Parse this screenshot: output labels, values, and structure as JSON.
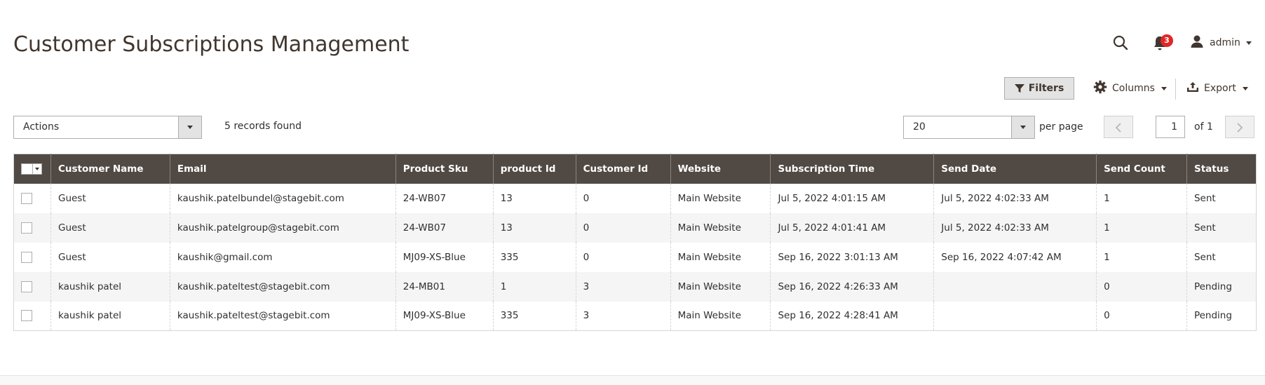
{
  "page": {
    "title": "Customer Subscriptions Management"
  },
  "header": {
    "notification_count": "3",
    "user_name": "admin"
  },
  "toolbar": {
    "filters_label": "Filters",
    "columns_label": "Columns",
    "export_label": "Export"
  },
  "grid_controls": {
    "actions_label": "Actions",
    "records_found": "5 records found",
    "per_page_value": "20",
    "per_page_label": "per page",
    "current_page": "1",
    "page_of": "of 1"
  },
  "table": {
    "columns": [
      "Customer Name",
      "Email",
      "Product Sku",
      "product Id",
      "Customer Id",
      "Website",
      "Subscription Time",
      "Send Date",
      "Send Count",
      "Status"
    ],
    "rows": [
      [
        "Guest",
        "kaushik.patelbundel@stagebit.com",
        "24-WB07",
        "13",
        "0",
        "Main Website",
        "Jul 5, 2022 4:01:15 AM",
        "Jul 5, 2022 4:02:33 AM",
        "1",
        "Sent"
      ],
      [
        "Guest",
        "kaushik.patelgroup@stagebit.com",
        "24-WB07",
        "13",
        "0",
        "Main Website",
        "Jul 5, 2022 4:01:41 AM",
        "Jul 5, 2022 4:02:33 AM",
        "1",
        "Sent"
      ],
      [
        "Guest",
        "kaushik@gmail.com",
        "MJ09-XS-Blue",
        "335",
        "0",
        "Main Website",
        "Sep 16, 2022 3:01:13 AM",
        "Sep 16, 2022 4:07:42 AM",
        "1",
        "Sent"
      ],
      [
        "kaushik patel",
        "kaushik.pateltest@stagebit.com",
        "24-MB01",
        "1",
        "3",
        "Main Website",
        "Sep 16, 2022 4:26:33 AM",
        "",
        "0",
        "Pending"
      ],
      [
        "kaushik patel",
        "kaushik.pateltest@stagebit.com",
        "MJ09-XS-Blue",
        "335",
        "3",
        "Main Website",
        "Sep 16, 2022 4:28:41 AM",
        "",
        "0",
        "Pending"
      ]
    ]
  },
  "colors": {
    "header_bg": "#514943",
    "badge": "#e22626",
    "text": "#303030"
  }
}
